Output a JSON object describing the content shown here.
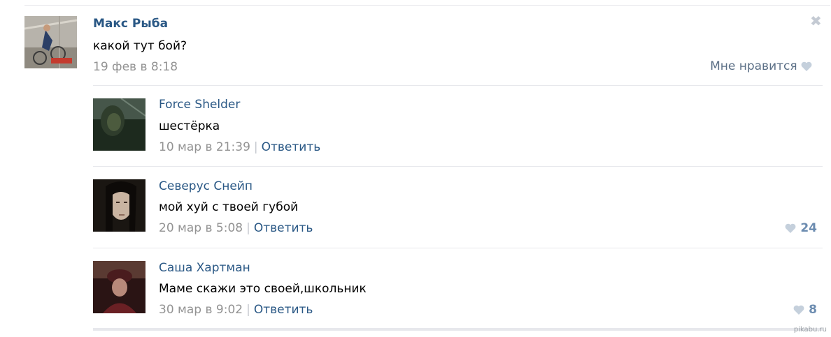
{
  "post": {
    "author": "Макс Рыба",
    "text": "какой тут бой?",
    "date": "19 фев в 8:18",
    "like_label": "Мне нравится"
  },
  "comments": [
    {
      "author": "Force Shelder",
      "text": "шестёрка",
      "date": "10 мар в 21:39",
      "reply": "Ответить",
      "likes": ""
    },
    {
      "author": "Северус Снейп",
      "text": "мой хуй с твоей губой",
      "date": "20 мар в 5:08",
      "reply": "Ответить",
      "likes": "24"
    },
    {
      "author": "Саша Хартман",
      "text": "Маме скажи это своей,школьник",
      "date": "30 мар в 9:02",
      "reply": "Ответить",
      "likes": "8"
    }
  ],
  "watermark": "pikabu.ru",
  "colors": {
    "link": "#2a5885",
    "meta": "#939393",
    "heart": "#c5d0dc",
    "like_count": "#6c8cb0"
  },
  "icons": {
    "close": "close-icon",
    "like": "heart-icon"
  }
}
